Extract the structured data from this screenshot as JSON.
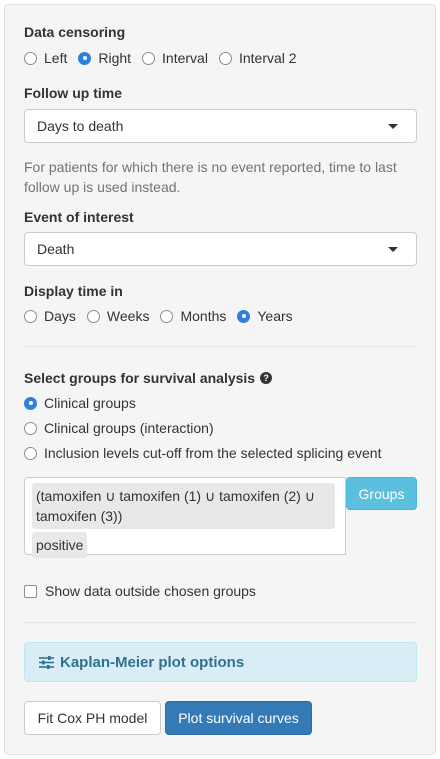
{
  "censoring": {
    "label": "Data censoring",
    "options": [
      "Left",
      "Right",
      "Interval",
      "Interval 2"
    ],
    "selected": "Right"
  },
  "follow_up": {
    "label": "Follow up time",
    "value": "Days to death",
    "help": "For patients for which there is no event reported, time to last follow up is used instead."
  },
  "event": {
    "label": "Event of interest",
    "value": "Death"
  },
  "display_time": {
    "label": "Display time in",
    "options": [
      "Days",
      "Weeks",
      "Months",
      "Years"
    ],
    "selected": "Years"
  },
  "groups": {
    "label": "Select groups for survival analysis",
    "options": [
      "Clinical groups",
      "Clinical groups (interaction)",
      "Inclusion levels cut-off from the selected splicing event"
    ],
    "selected": "Clinical groups",
    "chips": [
      "(tamoxifen ∪ tamoxifen (1) ∪ tamoxifen (2) ∪ tamoxifen (3))",
      "positive"
    ],
    "groups_button": "Groups",
    "show_outside": "Show data outside chosen groups"
  },
  "km": {
    "label": "Kaplan-Meier plot options"
  },
  "actions": {
    "fit_cox": "Fit Cox PH model",
    "plot": "Plot survival curves"
  },
  "colors": {
    "primary": "#337ab7",
    "info_button": "#5bc0de",
    "info_bg": "#d9edf7",
    "radio_checked": "#2f7fe0"
  }
}
